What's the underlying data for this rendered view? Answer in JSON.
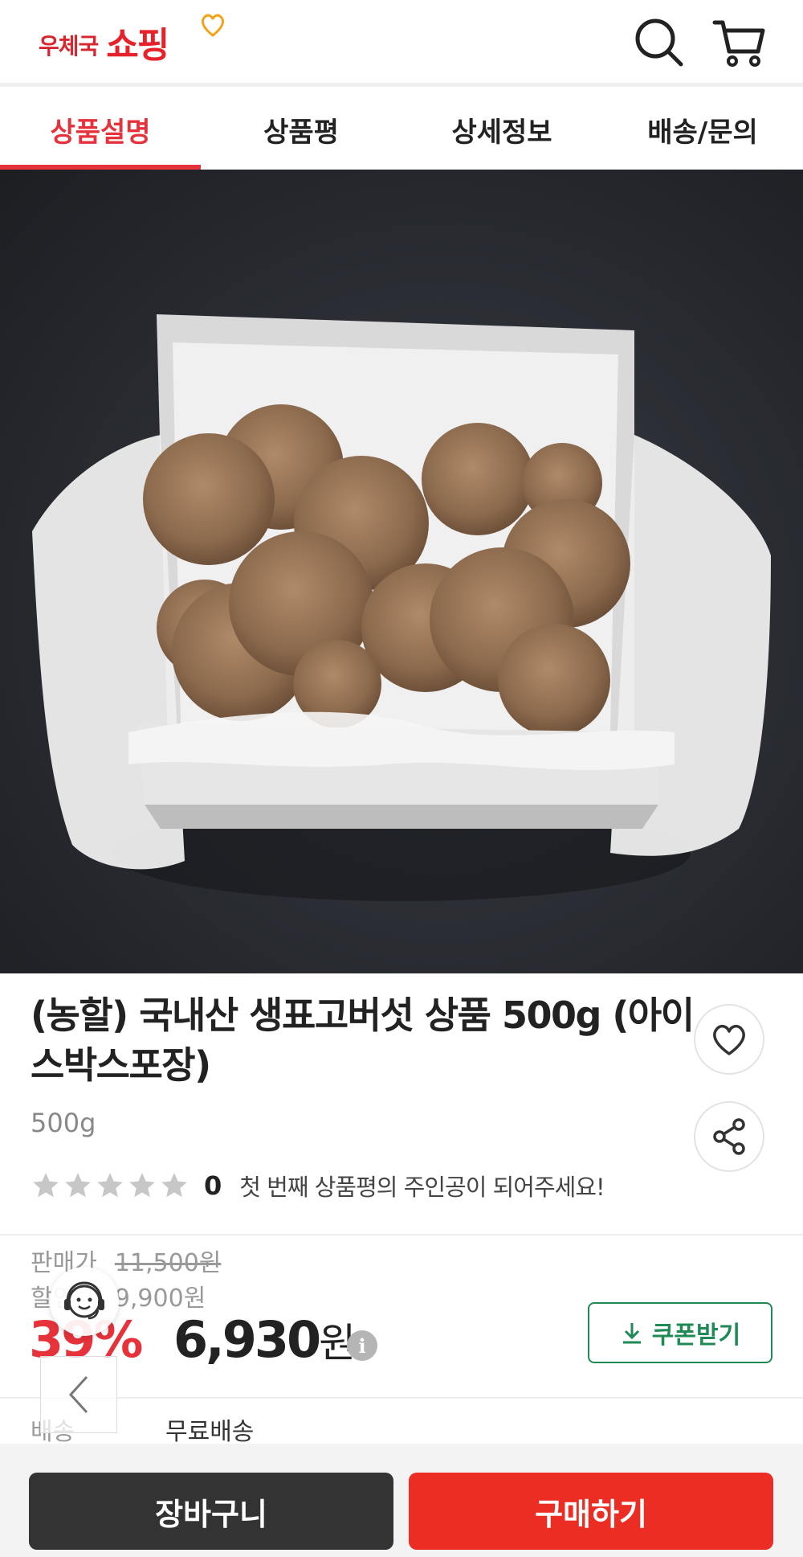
{
  "header": {
    "logo_small": "우체국",
    "logo_big": "쇼핑",
    "icons": [
      "search-icon",
      "cart-icon"
    ]
  },
  "tabs": [
    {
      "label": "상품설명",
      "active": true
    },
    {
      "label": "상품평",
      "active": false
    },
    {
      "label": "상세정보",
      "active": false
    },
    {
      "label": "배송/문의",
      "active": false
    }
  ],
  "product": {
    "title": "(농할) 국내산 생표고버섯 상품 500g (아이스박스포장)",
    "option": "500g",
    "rating": {
      "stars": 0,
      "count": "0",
      "message": "첫 번째 상품평의 주인공이 되어주세요!"
    }
  },
  "price": {
    "list_label": "판매가",
    "list_price": "11,500원",
    "sale_label": "할인가",
    "sale_price": "9,900원",
    "discount_rate": "39%",
    "final_amount": "6,930",
    "final_unit": "원",
    "coupon_label": "쿠폰받기"
  },
  "shipping": {
    "label": "배송",
    "value": "무료배송"
  },
  "actions": {
    "cart_label": "장바구니",
    "buy_label": "구매하기"
  },
  "colors": {
    "accent": "#e5323b",
    "coupon": "#1f8a55",
    "buy": "#ec2d23",
    "cart": "#333333"
  }
}
